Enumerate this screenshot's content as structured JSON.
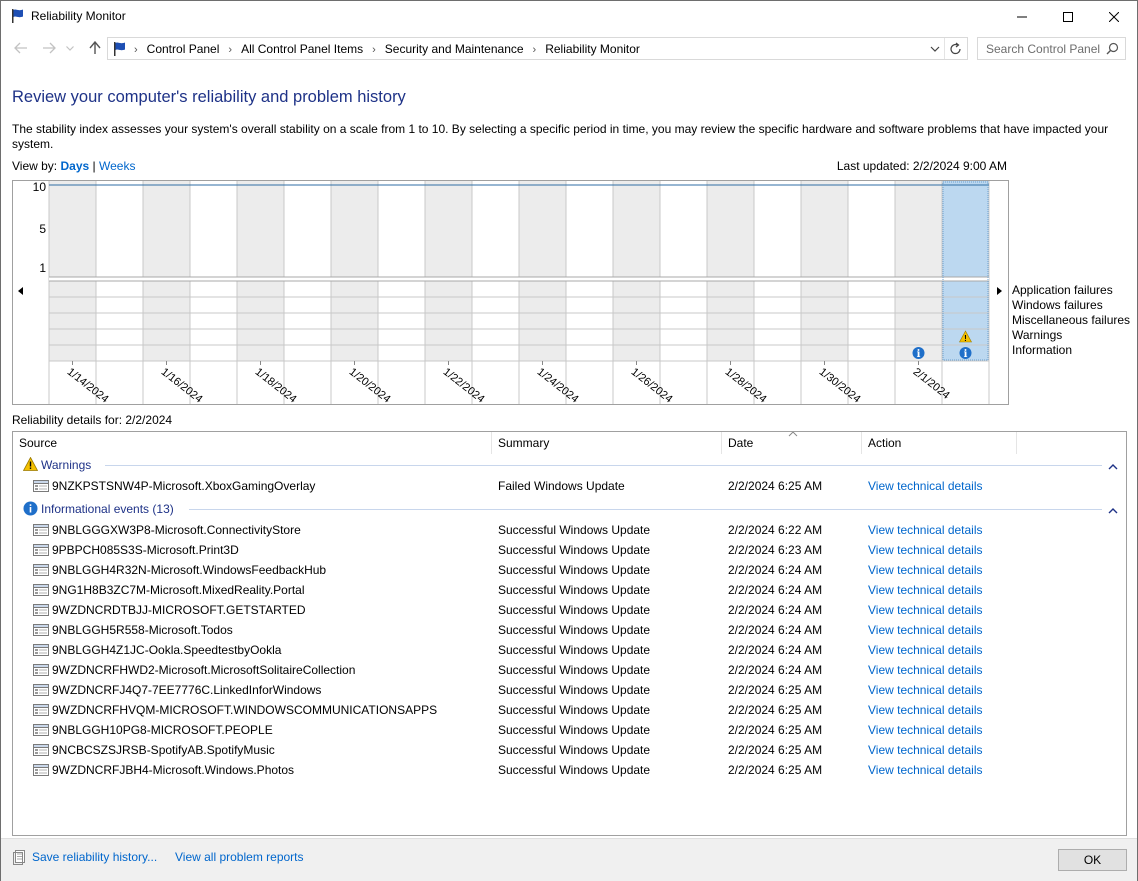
{
  "window": {
    "title": "Reliability Monitor"
  },
  "address": {
    "crumbs": [
      "Control Panel",
      "All Control Panel Items",
      "Security and Maintenance",
      "Reliability Monitor"
    ]
  },
  "search": {
    "placeholder": "Search Control Panel"
  },
  "page": {
    "heading": "Review your computer's reliability and problem history",
    "description": "The stability index assesses your system's overall stability on a scale from 1 to 10. By selecting a specific period in time, you may review the specific hardware and software problems that have impacted your system.",
    "view_by_label": "View by:",
    "view_days": "Days",
    "view_sep": "|",
    "view_weeks": "Weeks",
    "last_updated": "Last updated: 2/2/2024 9:00 AM",
    "details_for": "Reliability details for: 2/2/2024"
  },
  "chart_data": {
    "type": "table",
    "y_ticks": [
      "10",
      "5",
      "1"
    ],
    "x_labels": [
      "1/14/2024",
      "1/16/2024",
      "1/18/2024",
      "1/20/2024",
      "1/22/2024",
      "1/24/2024",
      "1/26/2024",
      "1/28/2024",
      "1/30/2024",
      "2/1/2024"
    ],
    "rows": [
      "Application failures",
      "Windows failures",
      "Miscellaneous failures",
      "Warnings",
      "Information"
    ],
    "days_shown": 20,
    "selected_day": "2/2/2024",
    "stability_index": 10,
    "events": [
      {
        "date": "2/1/2024",
        "row": "Information"
      },
      {
        "date": "2/2/2024",
        "row": "Warnings"
      },
      {
        "date": "2/2/2024",
        "row": "Information"
      }
    ]
  },
  "table": {
    "columns": [
      "Source",
      "Summary",
      "Date",
      "Action"
    ],
    "groups": [
      {
        "label": "Warnings",
        "icon": "warning-icon",
        "rows": [
          {
            "source": "9NZKPSTSNW4P-Microsoft.XboxGamingOverlay",
            "summary": "Failed Windows Update",
            "date": "2/2/2024 6:25 AM",
            "action": "View technical details"
          }
        ]
      },
      {
        "label": "Informational events (13)",
        "icon": "info-icon",
        "rows": [
          {
            "source": "9NBLGGGXW3P8-Microsoft.ConnectivityStore",
            "summary": "Successful Windows Update",
            "date": "2/2/2024 6:22 AM",
            "action": "View technical details"
          },
          {
            "source": "9PBPCH085S3S-Microsoft.Print3D",
            "summary": "Successful Windows Update",
            "date": "2/2/2024 6:23 AM",
            "action": "View technical details"
          },
          {
            "source": "9NBLGGH4R32N-Microsoft.WindowsFeedbackHub",
            "summary": "Successful Windows Update",
            "date": "2/2/2024 6:24 AM",
            "action": "View technical details"
          },
          {
            "source": "9NG1H8B3ZC7M-Microsoft.MixedReality.Portal",
            "summary": "Successful Windows Update",
            "date": "2/2/2024 6:24 AM",
            "action": "View technical details"
          },
          {
            "source": "9WZDNCRDTBJJ-MICROSOFT.GETSTARTED",
            "summary": "Successful Windows Update",
            "date": "2/2/2024 6:24 AM",
            "action": "View technical details"
          },
          {
            "source": "9NBLGGH5R558-Microsoft.Todos",
            "summary": "Successful Windows Update",
            "date": "2/2/2024 6:24 AM",
            "action": "View technical details"
          },
          {
            "source": "9NBLGGH4Z1JC-Ookla.SpeedtestbyOokla",
            "summary": "Successful Windows Update",
            "date": "2/2/2024 6:24 AM",
            "action": "View technical details"
          },
          {
            "source": "9WZDNCRFHWD2-Microsoft.MicrosoftSolitaireCollection",
            "summary": "Successful Windows Update",
            "date": "2/2/2024 6:24 AM",
            "action": "View technical details"
          },
          {
            "source": "9WZDNCRFJ4Q7-7EE7776C.LinkedInforWindows",
            "summary": "Successful Windows Update",
            "date": "2/2/2024 6:25 AM",
            "action": "View technical details"
          },
          {
            "source": "9WZDNCRFHVQM-MICROSOFT.WINDOWSCOMMUNICATIONSAPPS",
            "summary": "Successful Windows Update",
            "date": "2/2/2024 6:25 AM",
            "action": "View technical details"
          },
          {
            "source": "9NBLGGH10PG8-MICROSOFT.PEOPLE",
            "summary": "Successful Windows Update",
            "date": "2/2/2024 6:25 AM",
            "action": "View technical details"
          },
          {
            "source": "9NCBCSZSJRSB-SpotifyAB.SpotifyMusic",
            "summary": "Successful Windows Update",
            "date": "2/2/2024 6:25 AM",
            "action": "View technical details"
          },
          {
            "source": "9WZDNCRFJBH4-Microsoft.Windows.Photos",
            "summary": "Successful Windows Update",
            "date": "2/2/2024 6:25 AM",
            "action": "View technical details"
          }
        ]
      }
    ]
  },
  "footer": {
    "save_label": "Save reliability history...",
    "view_all_label": "View all problem reports",
    "ok_label": "OK"
  },
  "colors": {
    "heading": "#1e3287",
    "link": "#0066cc",
    "selected_column": "#bcd8f0",
    "alt_column": "#ececec"
  }
}
